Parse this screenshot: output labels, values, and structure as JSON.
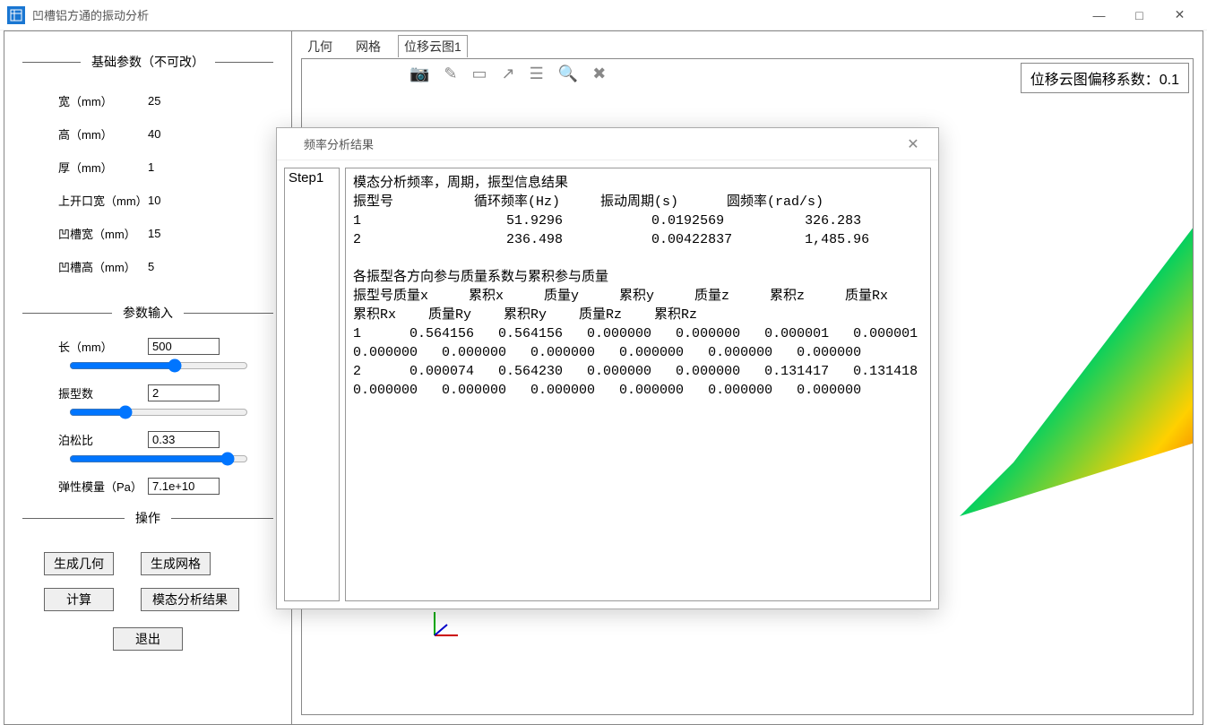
{
  "window": {
    "title": "凹槽铝方通的振动分析",
    "min": "—",
    "max": "□",
    "close": "✕"
  },
  "sections": {
    "basic_title": "基础参数（不可改）",
    "input_title": "参数输入",
    "ops_title": "操作"
  },
  "basic": {
    "width_label": "宽（mm）",
    "width_value": "25",
    "height_label": "高（mm）",
    "height_value": "40",
    "thick_label": "厚（mm）",
    "thick_value": "1",
    "open_label": "上开口宽（mm）",
    "open_value": "10",
    "slot_w_label": "凹槽宽（mm）",
    "slot_w_value": "15",
    "slot_h_label": "凹槽高（mm）",
    "slot_h_value": "5"
  },
  "inputs": {
    "length_label": "长（mm）",
    "length_value": "500",
    "modes_label": "振型数",
    "modes_value": "2",
    "poisson_label": "泊松比",
    "poisson_value": "0.33",
    "young_label": "弹性模量（Pa）",
    "young_value": "7.1e+10"
  },
  "ops": {
    "gen_geom": "生成几何",
    "gen_mesh": "生成网格",
    "compute": "计算",
    "modal_res": "模态分析结果",
    "exit": "退出"
  },
  "tabs": {
    "geom": "几何",
    "mesh": "网格",
    "disp": "位移云图1"
  },
  "viewport": {
    "offset_label": "位移云图偏移系数：",
    "offset_value": "0.1"
  },
  "dialog": {
    "title": "频率分析结果",
    "step": "Step1",
    "body": "模态分析频率，周期，振型信息结果\n振型号          循环频率(Hz)     振动周期(s)      圆频率(rad/s)\n1                  51.9296           0.0192569          326.283\n2                  236.498           0.00422837         1,485.96\n\n各振型各方向参与质量系数与累积参与质量\n振型号质量x     累积x     质量y     累积y     质量z     累积z     质量Rx    累积Rx    质量Ry    累积Ry    质量Rz    累积Rz\n1      0.564156   0.564156   0.000000   0.000000   0.000001   0.000001   0.000000   0.000000   0.000000   0.000000   0.000000   0.000000\n2      0.000074   0.564230   0.000000   0.000000   0.131417   0.131418   0.000000   0.000000   0.000000   0.000000   0.000000   0.000000"
  }
}
